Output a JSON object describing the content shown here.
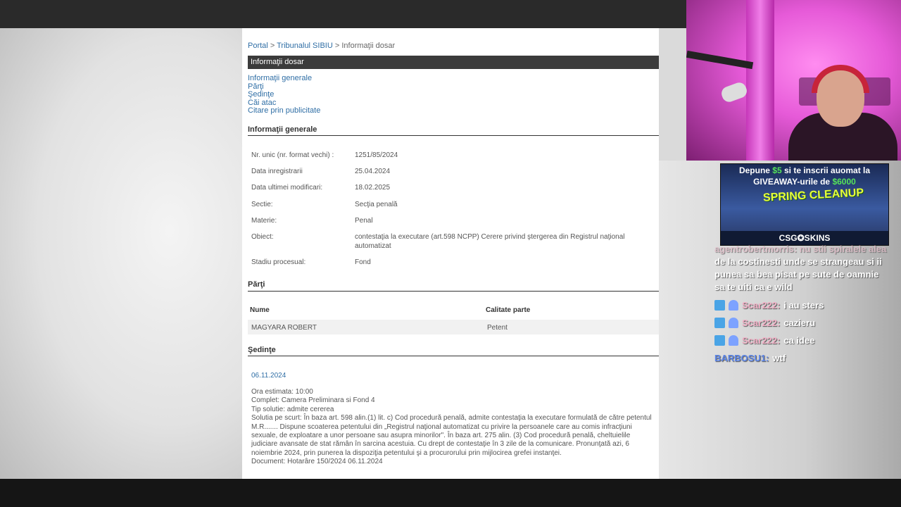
{
  "breadcrumb": {
    "portal": "Portal",
    "sep1": ">",
    "court": "Tribunalul SIBIU",
    "sep2": ">",
    "current": "Informaţii dosar"
  },
  "header": {
    "title": "Informaţii dosar"
  },
  "nav_links": [
    "Informaţii generale",
    "Părţi",
    "Şedinţe",
    "Căi atac",
    "Citare prin publicitate"
  ],
  "sections": {
    "general": "Informaţii generale",
    "parties": "Părţi",
    "hearings": "Şedinţe"
  },
  "general_info": [
    {
      "label": "Nr. unic (nr. format vechi) :",
      "value": "1251/85/2024"
    },
    {
      "label": "Data inregistrarii",
      "value": "25.04.2024"
    },
    {
      "label": "Data ultimei modificari:",
      "value": "18.02.2025"
    },
    {
      "label": "Sectie:",
      "value": "Secţia penală"
    },
    {
      "label": "Materie:",
      "value": "Penal"
    },
    {
      "label": "Obiect:",
      "value": "contestaţia la executare (art.598 NCPP) Cerere privind ştergerea din Registrul naţional automatizat"
    },
    {
      "label": "Stadiu procesual:",
      "value": "Fond"
    }
  ],
  "parties_table": {
    "headers": [
      "Nume",
      "Calitate parte"
    ],
    "rows": [
      {
        "name": "MAGYARA ROBERT",
        "role": "Petent"
      }
    ]
  },
  "hearing": {
    "date": "06.11.2024",
    "ora": "Ora estimata: 10:00",
    "complet": "Complet: Camera Preliminara si Fond 4",
    "tip": "Tip solutie: admite cererea",
    "solutie": "Solutia pe scurt: În baza art. 598 alin.(1) lit. c) Cod procedură penală, admite contestaţia la executare formulată de către petentul M.R....... Dispune scoaterea petentului din „Registrul naţional automatizat cu privire la persoanele care au comis infracţiuni sexuale, de exploatare a unor persoane sau asupra minorilor\". În baza art. 275 alin. (3) Cod procedură penală, cheltuielile judiciare avansate de stat rămân în sarcina acestuia. Cu drept de contestaţie în 3 zile de la comunicare. Pronunţată azi, 6 noiembrie 2024, prin punerea la dispoziţia petentului şi a procurorului prin mijlocirea grefei instanţei.",
    "document": "Document: Hotarâre  150/2024  06.11.2024"
  },
  "ad": {
    "line1_a": "Depune ",
    "line1_b": "$5",
    "line1_c": " si te inscrii auomat la",
    "line2_a": "GIVEAWAY-urile de ",
    "line2_b": "$6000",
    "banner": "SPRING CLEANUP",
    "brand": "CSG✪SKINS"
  },
  "chat": {
    "partial_user": "agentrobertmorris:",
    "partial_text_first": "nu stii spiralele alea",
    "partial_text_rest": "de la costinesti unde se strangeau si ii punea sa bea pisat pe sute de oamnie sa te uiti ca e wild",
    "messages": [
      {
        "user": "Scar222:",
        "text": "i au sters"
      },
      {
        "user": "Scar222:",
        "text": "cazieru"
      },
      {
        "user": "Scar222:",
        "text": "ca idee"
      }
    ],
    "last_user": "BARBOSU1:",
    "last_text": "wtf"
  },
  "colors": {
    "link": "#2f6ea5",
    "title_bar": "#3b3b3b",
    "webcam_pink": "#e65ad8"
  }
}
